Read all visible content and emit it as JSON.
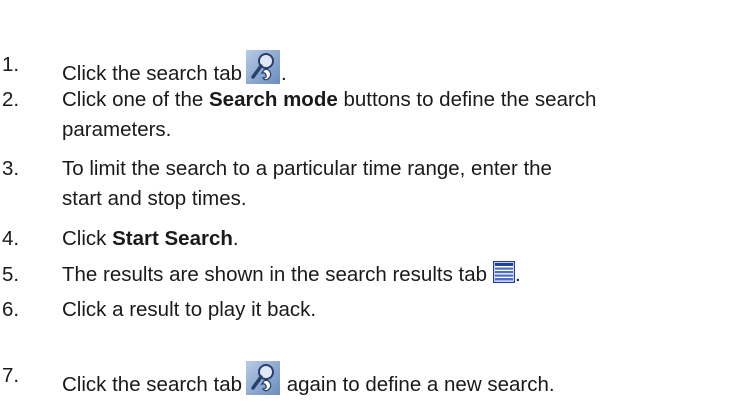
{
  "steps": [
    {
      "num": "1.",
      "before": "Click the search tab",
      "after": ".",
      "icon": "search-tab-icon"
    },
    {
      "num": "2.",
      "before": "Click one of the ",
      "bold": "Search mode",
      "after": " buttons to define the search",
      "line2": "parameters."
    },
    {
      "num": "3.",
      "text": "To limit the search to a particular time range, enter the",
      "line2": "start and stop times."
    },
    {
      "num": "4.",
      "before": "Click ",
      "bold": "Start Search",
      "after": "."
    },
    {
      "num": "5.",
      "before": "The results are shown in the search results tab",
      "after": ".",
      "icon": "search-results-tab-icon"
    },
    {
      "num": "6.",
      "text": "Click a result to play it back."
    },
    {
      "num": "7.",
      "before": "Click the search tab",
      "after": " again to define a new search.",
      "icon": "search-tab-icon"
    }
  ],
  "colors": {
    "text": "#1a1a1a",
    "icon_bg": "#7f9fc6",
    "icon_dark": "#2a3f6b",
    "list_icon_blue": "#1f3f9f"
  }
}
